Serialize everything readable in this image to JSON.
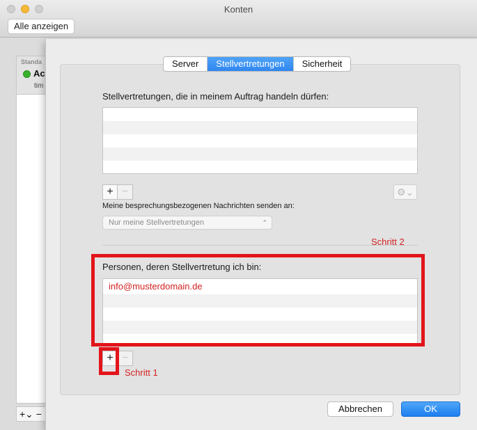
{
  "window": {
    "title": "Konten",
    "show_all_label": "Alle anzeigen"
  },
  "background_list": {
    "header_label": "Standa",
    "account_name": "Ac",
    "account_sub": "tim",
    "bottom_controls": "+⌄ −"
  },
  "tabs": [
    {
      "label": "Server",
      "active": false
    },
    {
      "label": "Stellvertretungen",
      "active": true
    },
    {
      "label": "Sicherheit",
      "active": false
    }
  ],
  "delegates_section": {
    "label": "Stellvertretungen, die in meinem Auftrag handeln dürfen:",
    "items": [],
    "add_label": "+",
    "remove_label": "−",
    "gear_icon": "gear-icon"
  },
  "meeting_messages": {
    "label": "Meine besprechungsbezogenen Nachrichten senden an:",
    "selected": "Nur meine Stellvertretungen"
  },
  "principals_section": {
    "label": "Personen, deren Stellvertretung ich bin:",
    "items": [
      "info@musterdomain.de"
    ],
    "add_label": "+",
    "remove_label": "−"
  },
  "annotations": {
    "step1": "Schritt 1",
    "step2": "Schritt 2",
    "color": "#e3141b"
  },
  "buttons": {
    "cancel": "Abbrechen",
    "ok": "OK"
  },
  "colors": {
    "accent": "#2f86ef",
    "annotation_text": "#d32222"
  }
}
